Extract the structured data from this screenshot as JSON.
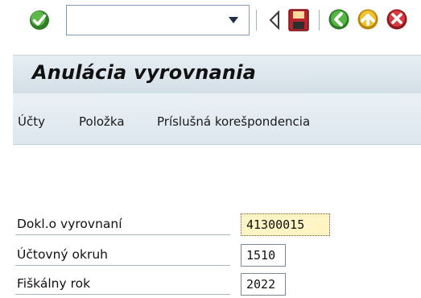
{
  "toolbar": {
    "enter_icon": "green-check-icon",
    "command_field": {
      "value": "",
      "placeholder": ""
    },
    "icons": [
      "chevron-down-icon",
      "back-triangle-icon",
      "save-icon",
      "back-icon",
      "exit-icon",
      "cancel-icon"
    ]
  },
  "screen": {
    "title": "Anulácia vyrovnania"
  },
  "app_toolbar": {
    "items": [
      {
        "label": "Účty"
      },
      {
        "label": "Položka"
      },
      {
        "label": "Príslušná korešpondencia"
      }
    ]
  },
  "form": {
    "fields": [
      {
        "label": "Dokl.o vyrovnaní",
        "value": "41300015"
      },
      {
        "label": "Účtovný okruh",
        "value": "1510"
      },
      {
        "label": "Fiškálny rok",
        "value": "2022"
      }
    ]
  },
  "colors": {
    "titlebar": "#dce7ee",
    "active_field": "#fff4c4",
    "enter_green": "#3a8f2a",
    "save_red": "#c3282f"
  }
}
